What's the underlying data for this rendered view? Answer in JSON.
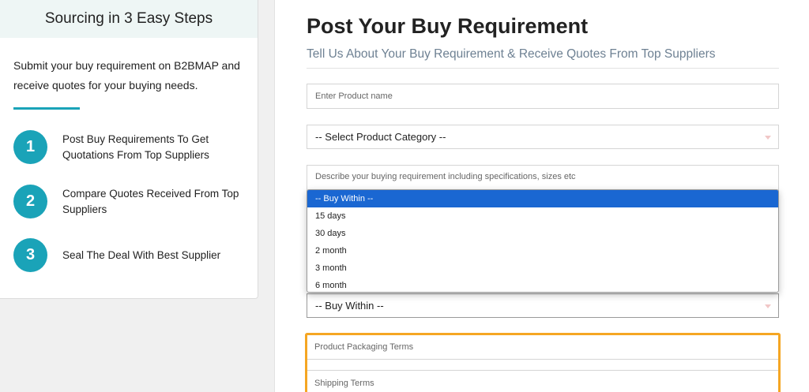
{
  "sidebar": {
    "title": "Sourcing in 3 Easy Steps",
    "description": "Submit your buy requirement on B2BMAP and receive quotes for your buying needs.",
    "steps": [
      {
        "num": "1",
        "text": "Post Buy Requirements To Get Quotations From Top Suppliers"
      },
      {
        "num": "2",
        "text": "Compare Quotes Received From Top Suppliers"
      },
      {
        "num": "3",
        "text": "Seal The Deal With Best Supplier"
      }
    ]
  },
  "form": {
    "title": "Post Your Buy Requirement",
    "subtitle": "Tell Us About Your Buy Requirement & Receive Quotes From Top Suppliers",
    "product_name_placeholder": "Enter Product name",
    "category_select": "-- Select Product Category --",
    "description_placeholder": "Describe your buying requirement including specifications, sizes etc",
    "buy_within_select": "-- Buy Within --",
    "buy_within_options": [
      "-- Buy Within --",
      "15 days",
      "30 days",
      "2 month",
      "3 month",
      "6 month"
    ],
    "packaging_placeholder": "Product Packaging Terms",
    "shipping_placeholder": "Shipping Terms"
  },
  "colors": {
    "accent": "#1aa3b8",
    "highlight": "#f5a623",
    "selected_option": "#1a67d2"
  }
}
